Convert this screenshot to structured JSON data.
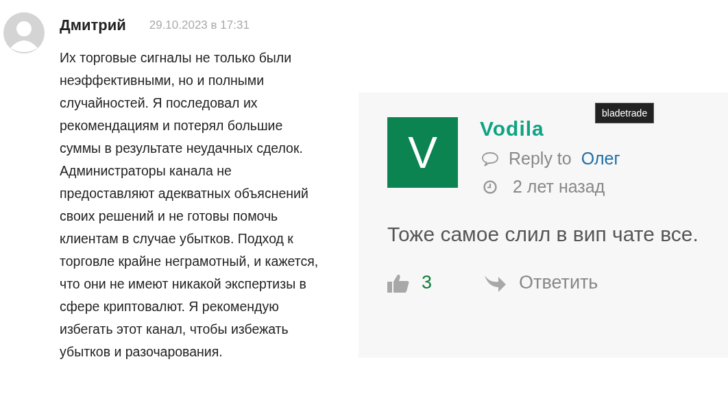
{
  "comment": {
    "author": "Дмитрий",
    "date": "29.10.2023 в 17:31",
    "text": "Их торговые сигналы не только были неэффективными, но и полными случайностей. Я последовал их рекомендациям и потерял большие суммы в результате неудачных сделок. Администраторы канала не предоставляют адекватных объяснений своих решений и не готовы помочь клиентам в случае убытков. Подход к торговле крайне неграмотный, и кажется, что они не имеют никакой экспертизы в сфере криптовалют. Я рекомендую избегать этот канал, чтобы избежать убытков и разочарования."
  },
  "reply_card": {
    "avatar_letter": "V",
    "author": "Vodila",
    "tooltip": "bladetrade",
    "reply_to_label": "Reply to",
    "reply_to_name": "Олег",
    "time": "2 лет назад",
    "text": "Тоже самое слил в вип чате все.",
    "likes": "3",
    "reply_action": "Ответить"
  }
}
